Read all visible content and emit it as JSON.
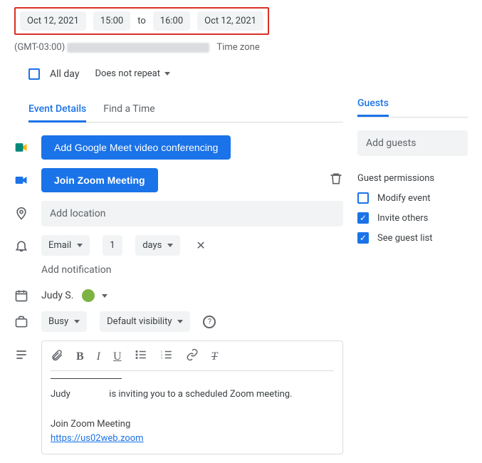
{
  "dateTime": {
    "startDate": "Oct 12, 2021",
    "startTime": "15:00",
    "to": "to",
    "endTime": "16:00",
    "endDate": "Oct 12, 2021",
    "tzOffset": "(GMT-03:00)",
    "tzLink": "Time zone"
  },
  "allDay": {
    "label": "All day"
  },
  "repeat": {
    "label": "Does not repeat"
  },
  "tabs": {
    "details": "Event Details",
    "findTime": "Find a Time"
  },
  "buttons": {
    "addMeet": "Add Google Meet video conferencing",
    "joinZoom": "Join Zoom Meeting"
  },
  "location": {
    "placeholder": "Add location"
  },
  "notification": {
    "channel": "Email",
    "count": "1",
    "unit": "days",
    "addLabel": "Add notification"
  },
  "owner": {
    "name": "Judy S."
  },
  "availability": {
    "busy": "Busy",
    "visibility": "Default visibility"
  },
  "description": {
    "line1a": "Judy",
    "line1b": "is inviting you to a scheduled Zoom meeting.",
    "joinLabel": "Join Zoom Meeting",
    "url": "https://us02web.zoom"
  },
  "guests": {
    "title": "Guests",
    "add": "Add guests",
    "permTitle": "Guest permissions",
    "modify": "Modify event",
    "invite": "Invite others",
    "seeList": "See guest list"
  }
}
